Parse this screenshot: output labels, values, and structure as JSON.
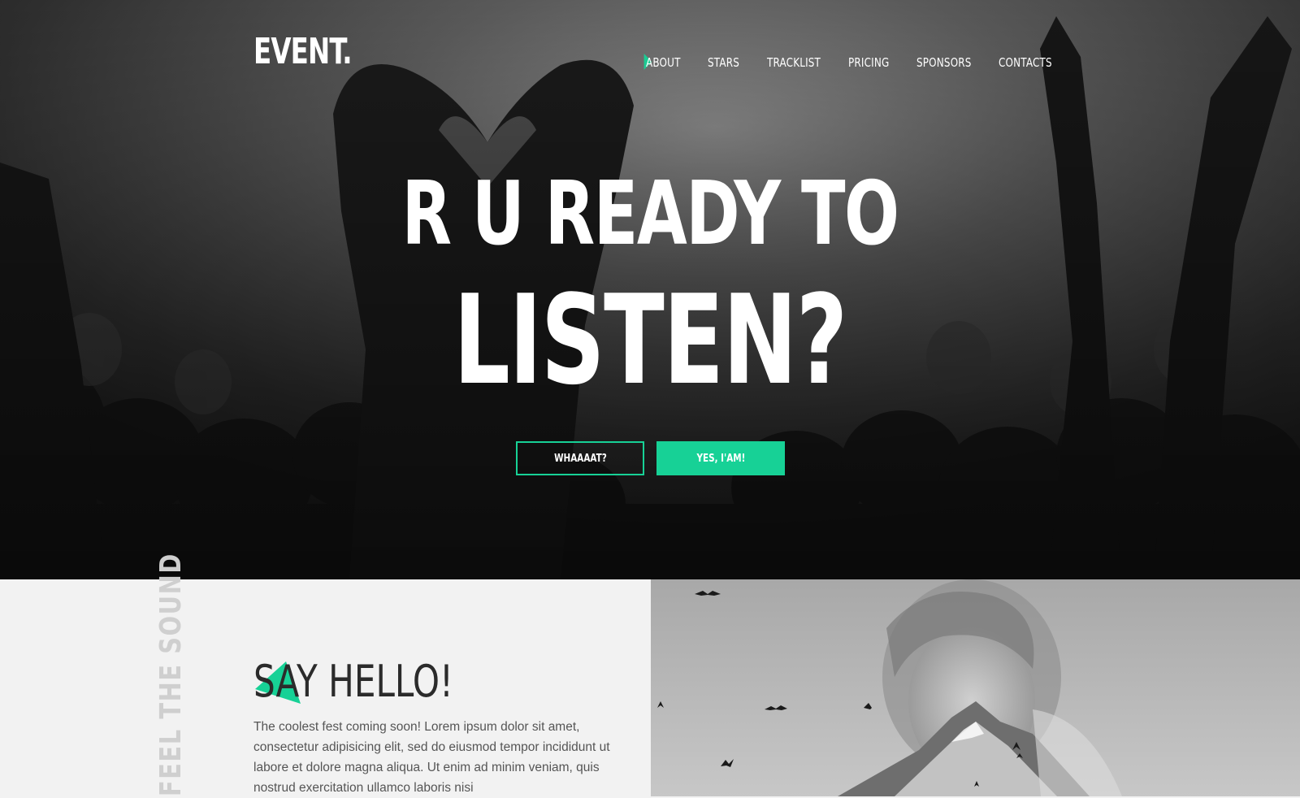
{
  "brand": {
    "logo_text": "EVENT."
  },
  "nav": {
    "items": [
      {
        "label": "ABOUT",
        "active": true
      },
      {
        "label": "STARS",
        "active": false
      },
      {
        "label": "TRACKLIST",
        "active": false
      },
      {
        "label": "PRICING",
        "active": false
      },
      {
        "label": "SPONSORS",
        "active": false
      },
      {
        "label": "CONTACTS",
        "active": false
      }
    ],
    "active_marker_color": "#17d196"
  },
  "hero": {
    "headline_line1": "R U READY TO",
    "headline_line2": "LISTEN?",
    "buttons": {
      "secondary_label": "WHAAAAT?",
      "primary_label": "YES, I'AM!"
    },
    "background": "grayscale concert crowd with hands making a heart shape"
  },
  "about": {
    "vertical_text": "FEEL THE SOUND",
    "title": "SAY HELLO!",
    "body": "The coolest fest coming soon! Lorem ipsum dolor sit amet, consectetur adipisicing elit, sed do eiusmod tempor incididunt ut labore et dolore magna aliqua. Ut enim ad minim veniam, quis nostrud exercitation ullamco laboris nisi",
    "image": "double exposure portrait of a woman with mountains and birds"
  },
  "colors": {
    "accent": "#17d196",
    "dark_text": "#2b2b2b",
    "body_text": "#555555",
    "section_bg": "#f2f2f2"
  }
}
